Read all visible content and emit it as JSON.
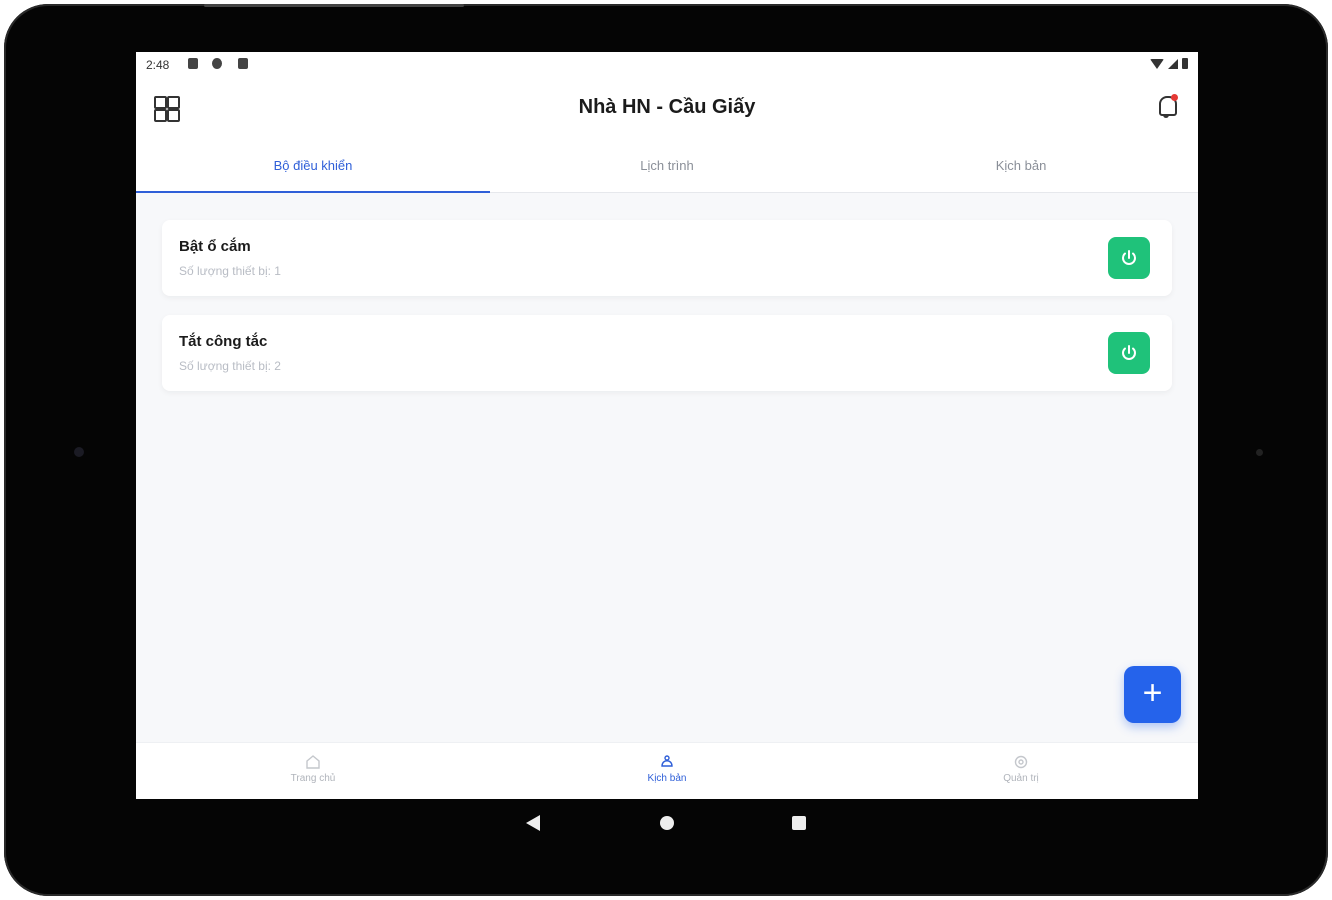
{
  "statusbar": {
    "time": "2:48"
  },
  "header": {
    "title": "Nhà HN - Cầu Giấy"
  },
  "tabs": [
    {
      "label": "Bộ điều khiển",
      "active": true
    },
    {
      "label": "Lịch trình",
      "active": false
    },
    {
      "label": "Kịch bản",
      "active": false
    }
  ],
  "scenarios": [
    {
      "title": "Bật ổ cắm",
      "subtitle": "Số lượng thiết bị: 1"
    },
    {
      "title": "Tắt công tắc",
      "subtitle": "Số lượng thiết bị: 2"
    }
  ],
  "fab": {
    "icon": "plus-icon",
    "label": "+"
  },
  "bottom_nav": [
    {
      "label": "Trang chủ",
      "icon": "home-icon",
      "active": false
    },
    {
      "label": "Kịch bản",
      "icon": "scenario-icon",
      "active": true
    },
    {
      "label": "Quản trị",
      "icon": "settings-icon",
      "active": false
    }
  ],
  "colors": {
    "accent": "#2f5fd8",
    "power": "#1fc27a",
    "fab": "#2563eb",
    "notification": "#e53935"
  }
}
